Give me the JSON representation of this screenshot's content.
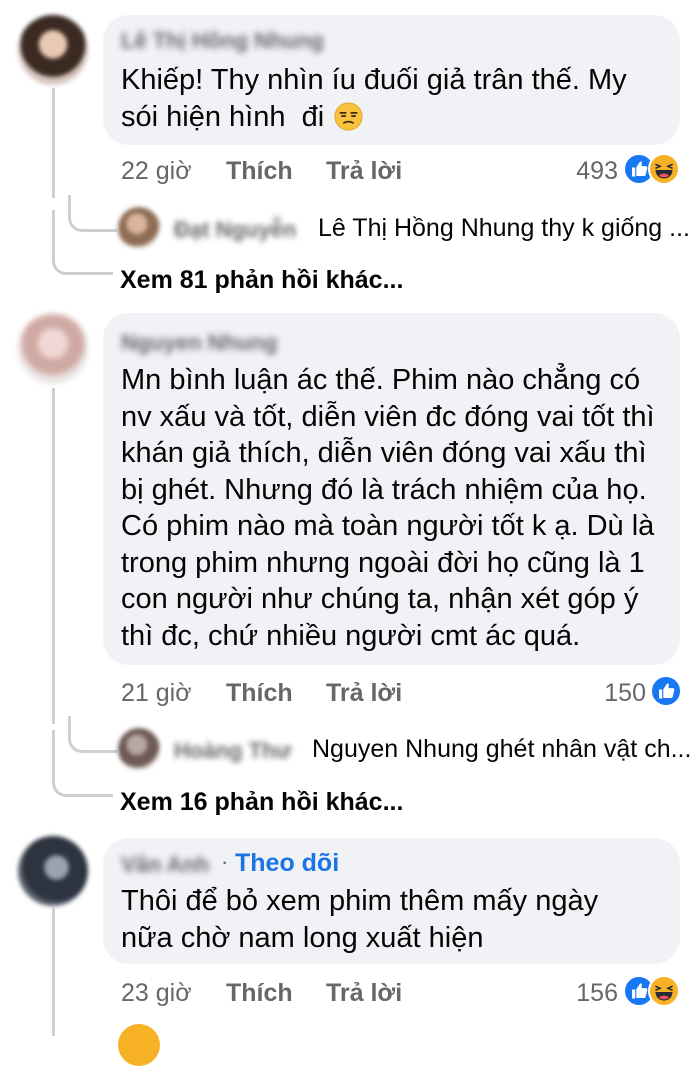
{
  "colors": {
    "bubble": "#f0f2f5",
    "meta": "#65676b",
    "link": "#1b74e4",
    "like": "#1877f2",
    "haha": "#f7b125"
  },
  "comments": [
    {
      "author": "Lê Thị Hồng Nhung",
      "lines": [
        "Khiếp! Thy nhìn íu đuối giả trân thế. My",
        "sói hiện hình  đi"
      ],
      "emoji": "unamused-face",
      "time": "22 giờ",
      "like": "Thích",
      "reply": "Trả lời",
      "reaction_count": "493",
      "reactions": [
        "like-icon",
        "haha-icon"
      ],
      "reply_preview": {
        "author": "Đạt Nguyễn",
        "text": "Lê Thị Hồng Nhung thy k giống ..."
      },
      "more_replies": "Xem 81 phản hồi khác..."
    },
    {
      "author": "Nguyen Nhung",
      "lines": [
        "Mn bình luận ác thế. Phim nào chẳng có",
        "nv xấu và tốt, diễn viên đc đóng vai tốt thì",
        "khán giả thích, diễn viên đóng vai xấu thì",
        "bị ghét. Nhưng đó là trách nhiệm của họ.",
        "Có phim nào mà toàn người tốt k ạ. Dù là",
        "trong phim nhưng ngoài đời họ cũng là 1",
        "con người như chúng ta, nhận xét góp ý",
        "thì đc, chứ nhiều người cmt ác quá."
      ],
      "time": "21 giờ",
      "like": "Thích",
      "reply": "Trả lời",
      "reaction_count": "150",
      "reactions": [
        "like-icon"
      ],
      "reply_preview": {
        "author": "Hoàng Thư",
        "text": "Nguyen Nhung ghét nhân vật ch..."
      },
      "more_replies": "Xem 16 phản hồi khác..."
    },
    {
      "author": "Vân Anh",
      "follow": "Theo dõi",
      "lines": [
        "Thôi để bỏ xem phim thêm mấy ngày",
        "nữa chờ nam long xuất hiện"
      ],
      "time": "23 giờ",
      "like": "Thích",
      "reply": "Trả lời",
      "reaction_count": "156",
      "reactions": [
        "like-icon",
        "haha-icon"
      ]
    }
  ]
}
